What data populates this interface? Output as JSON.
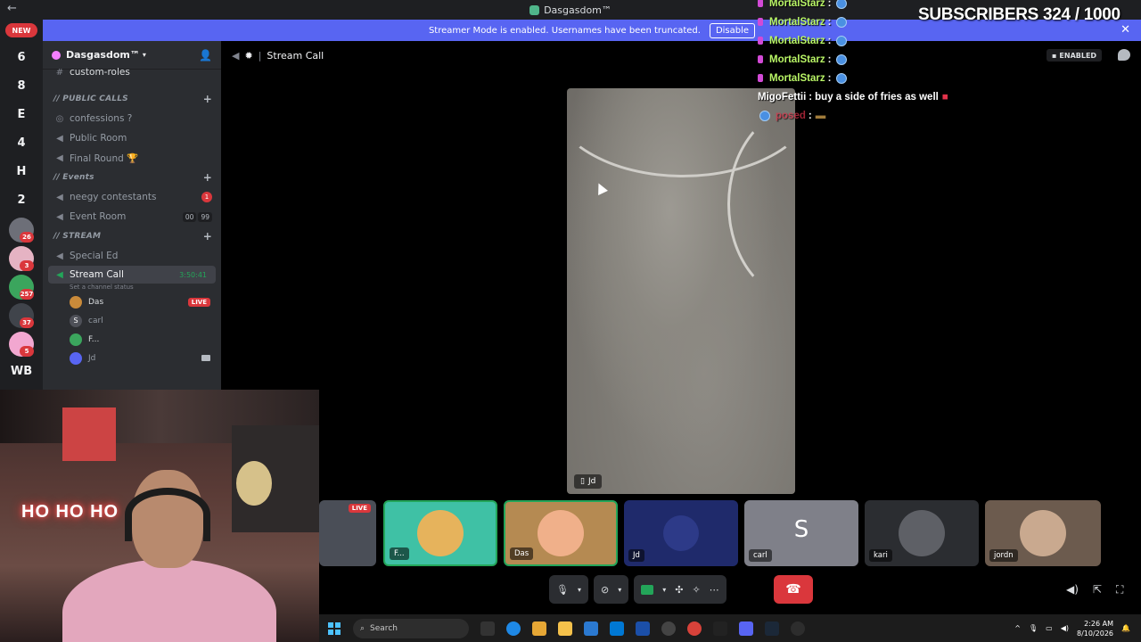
{
  "window": {
    "title": "Dasgasdom™"
  },
  "banner": {
    "text": "Streamer Mode is enabled. Usernames have been truncated.",
    "disable_label": "Disable"
  },
  "rail": {
    "new_label": "NEW",
    "items": [
      "6",
      "8",
      "E",
      "4",
      "H",
      "2"
    ],
    "badges": [
      "26",
      "3",
      "257",
      "37",
      "5"
    ],
    "wb_label": "WB"
  },
  "server": {
    "name": "Dasgasdom™",
    "channels": {
      "custom_roles": "custom-roles",
      "cat_public": "// PUBLIC CALLS",
      "confessions": "confessions ?",
      "public_room": "Public Room",
      "final_round": "Final Round 🏆",
      "cat_events": "// Events",
      "neegy": "neegy contestants",
      "neegy_badge": "1",
      "event_room": "Event Room",
      "event_counts": [
        "00",
        "99"
      ],
      "cat_stream": "// STREAM",
      "special_ed": "Special Ed",
      "stream_call": "Stream Call",
      "stream_timer": "3:50:41",
      "status_sub": "Set a channel status"
    },
    "members": [
      {
        "name": "Das",
        "color": "#c98a3a",
        "initial": ""
      },
      {
        "name": "carl",
        "color": "#4e5058",
        "initial": "S"
      },
      {
        "name": "F...",
        "color": "#3ba55d",
        "initial": ""
      },
      {
        "name": "Jd",
        "color": "#5865f2",
        "initial": ""
      }
    ],
    "live_label": "LIVE"
  },
  "call": {
    "channel": "Stream Call",
    "enabled_label": "ENABLED",
    "video_user": "Jd"
  },
  "overlay": {
    "subs": "SUBSCRIBERS 324 / 1000",
    "chat": [
      {
        "user": "MortalStarz",
        "msg": ""
      },
      {
        "user": "MortalStarz",
        "msg": ""
      },
      {
        "user": "MortalStarz",
        "msg": ""
      },
      {
        "user": "MortalStarz",
        "msg": ""
      },
      {
        "user": "MortalStarz",
        "msg": ""
      }
    ],
    "migo_user": "MigoFettii",
    "migo_msg": "buy a side of fries as well",
    "last_user": "posed"
  },
  "tiles": [
    {
      "name": "",
      "live": "LIVE"
    },
    {
      "name": "F..."
    },
    {
      "name": "Das"
    },
    {
      "name": "Jd"
    },
    {
      "name": "carl",
      "letter": "S"
    },
    {
      "name": "kari"
    },
    {
      "name": "jordn"
    }
  ],
  "taskbar": {
    "search": "Search",
    "time": "2:26 AM",
    "date": "8/10/2026"
  },
  "webcam": {
    "neon": "HO HO HO"
  }
}
